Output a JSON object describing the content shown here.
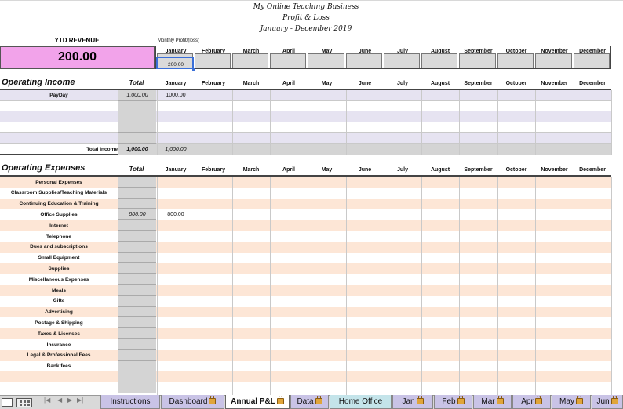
{
  "title": {
    "line1": "My Online Teaching Business",
    "line2": "Profit & Loss",
    "line3": "January - December 2019"
  },
  "ytd": {
    "label": "YTD REVENUE",
    "value": "200.00"
  },
  "monthly_label": "Monthly Profit/(loss)",
  "months": [
    "January",
    "February",
    "March",
    "April",
    "May",
    "June",
    "July",
    "August",
    "September",
    "October",
    "November",
    "December"
  ],
  "monthly_profit": [
    "200.00",
    "",
    "",
    "",
    "",
    "",
    "",
    "",
    "",
    "",
    "",
    ""
  ],
  "income": {
    "title": "Operating Income",
    "total_header": "Total",
    "rows": [
      {
        "label": "PayDay",
        "total": "1,000.00",
        "jan": "1000.00"
      },
      {
        "label": "",
        "total": "",
        "jan": ""
      },
      {
        "label": "",
        "total": "",
        "jan": ""
      },
      {
        "label": "",
        "total": "",
        "jan": ""
      },
      {
        "label": "",
        "total": "",
        "jan": ""
      }
    ],
    "total_label": "Total Income",
    "total_value": "1,000.00",
    "total_jan": "1,000.00"
  },
  "expenses": {
    "title": "Operating Expenses",
    "total_header": "Total",
    "rows": [
      {
        "label": "Personal Expenses",
        "total": "",
        "jan": ""
      },
      {
        "label": "Classroom Supplies/Teaching Materials",
        "total": "",
        "jan": ""
      },
      {
        "label": "Continuing Education & Training",
        "total": "",
        "jan": ""
      },
      {
        "label": "Office Supplies",
        "total": "800.00",
        "jan": "800.00"
      },
      {
        "label": "Internet",
        "total": "",
        "jan": ""
      },
      {
        "label": "Telephone",
        "total": "",
        "jan": ""
      },
      {
        "label": "Dues and subscriptions",
        "total": "",
        "jan": ""
      },
      {
        "label": "Small Equipment",
        "total": "",
        "jan": ""
      },
      {
        "label": "Supplies",
        "total": "",
        "jan": ""
      },
      {
        "label": "Miscellaneous Expenses",
        "total": "",
        "jan": ""
      },
      {
        "label": "Meals",
        "total": "",
        "jan": ""
      },
      {
        "label": "Gifts",
        "total": "",
        "jan": ""
      },
      {
        "label": "Advertising",
        "total": "",
        "jan": ""
      },
      {
        "label": "Postage & Shipping",
        "total": "",
        "jan": ""
      },
      {
        "label": "Taxes & Licenses",
        "total": "",
        "jan": ""
      },
      {
        "label": "Insurance",
        "total": "",
        "jan": ""
      },
      {
        "label": "Legal & Professional Fees",
        "total": "",
        "jan": ""
      },
      {
        "label": "Bank fees",
        "total": "",
        "jan": ""
      },
      {
        "label": "",
        "total": "",
        "jan": ""
      },
      {
        "label": "",
        "total": "",
        "jan": ""
      }
    ]
  },
  "tabs": [
    {
      "label": "Instructions",
      "locked": false,
      "active": false,
      "color": "#c9c3e6"
    },
    {
      "label": "Dashboard",
      "locked": true,
      "active": false,
      "color": "#c9c3e6"
    },
    {
      "label": "Annual P&L",
      "locked": true,
      "active": true,
      "color": "#ffffff"
    },
    {
      "label": "Data",
      "locked": true,
      "active": false,
      "color": "#c9c3e6"
    },
    {
      "label": "Home Office",
      "locked": false,
      "active": false,
      "color": "#c4e4ea"
    },
    {
      "label": "Jan",
      "locked": true,
      "active": false,
      "color": "#c9c3e6"
    },
    {
      "label": "Feb",
      "locked": true,
      "active": false,
      "color": "#c9c3e6"
    },
    {
      "label": "Mar",
      "locked": true,
      "active": false,
      "color": "#c9c3e6"
    },
    {
      "label": "Apr",
      "locked": true,
      "active": false,
      "color": "#c9c3e6"
    },
    {
      "label": "May",
      "locked": true,
      "active": false,
      "color": "#c9c3e6"
    },
    {
      "label": "Jun",
      "locked": true,
      "active": false,
      "color": "#c9c3e6"
    }
  ],
  "colors": {
    "ytd_pink": "#f2a3ea",
    "income_stripe": "#e6e3f1",
    "expense_stripe": "#fde6d6",
    "total_gray": "#d4d4d4",
    "profit_gray": "#dadada",
    "selection_blue": "#3a6fd8"
  },
  "icons": {
    "nav_first": "first-sheet-icon",
    "nav_prev": "prev-sheet-icon",
    "nav_next": "next-sheet-icon",
    "nav_last": "last-sheet-icon",
    "view_normal": "normal-view-icon",
    "view_layout": "page-layout-icon",
    "tab_lock": "lock-icon"
  }
}
